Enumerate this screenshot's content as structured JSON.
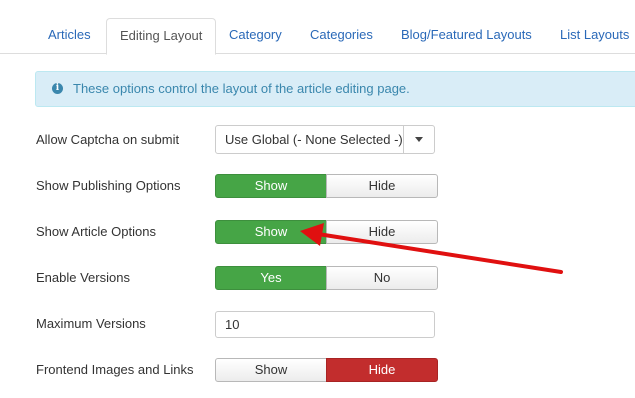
{
  "tabs": [
    {
      "label": "Articles",
      "active": false
    },
    {
      "label": "Editing Layout",
      "active": true
    },
    {
      "label": "Category",
      "active": false
    },
    {
      "label": "Categories",
      "active": false
    },
    {
      "label": "Blog/Featured Layouts",
      "active": false
    },
    {
      "label": "List Layouts",
      "active": false
    }
  ],
  "alert": {
    "icon": "info-icon",
    "text": "These options control the layout of the article editing page."
  },
  "fields": {
    "captcha": {
      "label": "Allow Captcha on submit",
      "value": "Use Global (- None Selected -)"
    },
    "publishing": {
      "label": "Show Publishing Options",
      "options": [
        "Show",
        "Hide"
      ],
      "selected": "Show"
    },
    "article_options": {
      "label": "Show Article Options",
      "options": [
        "Show",
        "Hide"
      ],
      "selected": "Show"
    },
    "versions": {
      "label": "Enable Versions",
      "options": [
        "Yes",
        "No"
      ],
      "selected": "Yes"
    },
    "max_versions": {
      "label": "Maximum Versions",
      "value": "10"
    },
    "frontend_images": {
      "label": "Frontend Images and Links",
      "options": [
        "Show",
        "Hide"
      ],
      "selected": "Hide"
    }
  },
  "colors": {
    "selected_green": "#46a546",
    "selected_red": "#c22d2d",
    "annotation_arrow": "#e01010",
    "link_blue": "#2a69b8"
  }
}
